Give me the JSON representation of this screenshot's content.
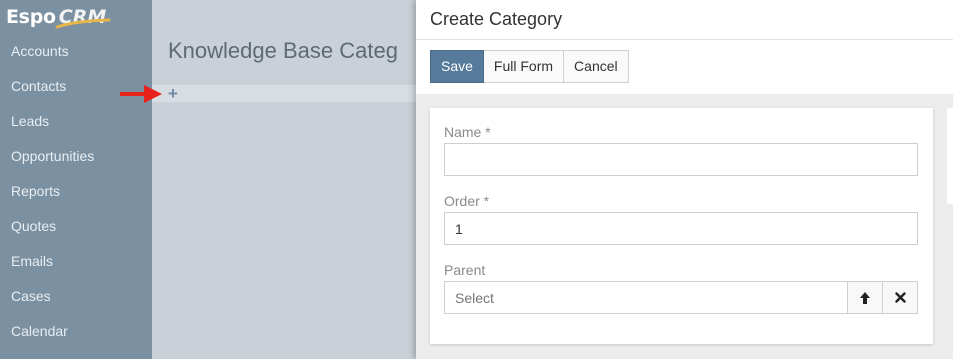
{
  "app": {
    "logo_left": "Espo",
    "logo_right": "CRM",
    "brand_color": "#7b90a0",
    "accent_color": "#e7b64a"
  },
  "sidebar": {
    "items": [
      {
        "label": "Accounts"
      },
      {
        "label": "Contacts"
      },
      {
        "label": "Leads"
      },
      {
        "label": "Opportunities"
      },
      {
        "label": "Reports"
      },
      {
        "label": "Quotes"
      },
      {
        "label": "Emails"
      },
      {
        "label": "Cases"
      },
      {
        "label": "Calendar"
      }
    ]
  },
  "main": {
    "page_title": "Knowledge Base Categ",
    "create_icon": "plus-icon",
    "annotation_color": "#e8231c"
  },
  "modal": {
    "title": "Create Category",
    "buttons": {
      "save": "Save",
      "full_form": "Full Form",
      "cancel": "Cancel"
    },
    "primary_color": "#567a9a",
    "fields": {
      "name": {
        "label": "Name *",
        "value": ""
      },
      "order": {
        "label": "Order *",
        "value": "1"
      },
      "parent": {
        "label": "Parent",
        "placeholder": "Select",
        "select_icon": "arrow-up-icon",
        "clear_icon": "close-icon"
      }
    }
  }
}
